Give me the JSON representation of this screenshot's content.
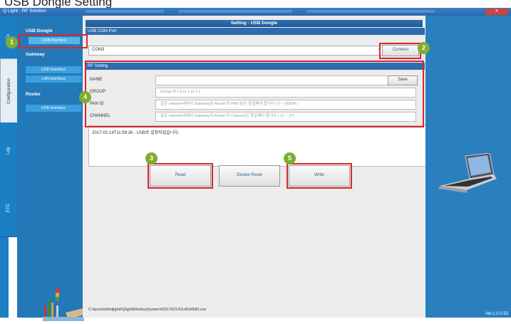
{
  "doc_heading": "USB Dongle Setting",
  "window": {
    "title": "Q Light - RF Solution",
    "close_label": "Close"
  },
  "tabs": [
    "Co",
    "Configuration",
    "Log",
    "ETC"
  ],
  "sidebar": {
    "usb_dongle": {
      "label": "USB Dongle",
      "item": "USB Interface"
    },
    "gateway": {
      "label": "Gateway",
      "items": [
        "USB Interface",
        "LAN Interface"
      ]
    },
    "router": {
      "label": "Router",
      "item": "USB Interface"
    }
  },
  "main": {
    "header": "Setting - USB Dongle",
    "com_section": "USB COM Port",
    "com_value": "COM3",
    "connect_label": "Connect",
    "rf_section": "RF Setting",
    "rf_fields": {
      "name_label": "NAME",
      "name_value": "",
      "save_label": "Save",
      "group_label": "GROUP",
      "group_placeholder": "Group ID ( 0 or 1 or 2 )",
      "panid_label": "PAN ID",
      "panid_placeholder": "같은 network내에서 Gateway와 Router의 PAN ID는 동일해야 합니다 ( 0 ~ 65534 )",
      "channel_label": "CHANNEL",
      "channel_placeholder": "같은 network내에서 Gateway와 Router의 Channel은 동일해야 합니다 ( 11 ~ 27)"
    },
    "log_text": "2017-02-14T11:59:26 - USB로 설정되었습니다.",
    "buttons": {
      "read": "Read",
      "device_reset": "Device Reset",
      "write": "Write"
    },
    "status_path": "C:#prochild#qlight#QlightWirelessSystem#20170214114034583.csv"
  },
  "version": "Ver.1.0.0.53",
  "badges": [
    "1",
    "2",
    "3",
    "4",
    "5"
  ],
  "colors": {
    "accent": "#2378b8",
    "highlight": "#d9262b",
    "badge": "#7fae2e"
  }
}
